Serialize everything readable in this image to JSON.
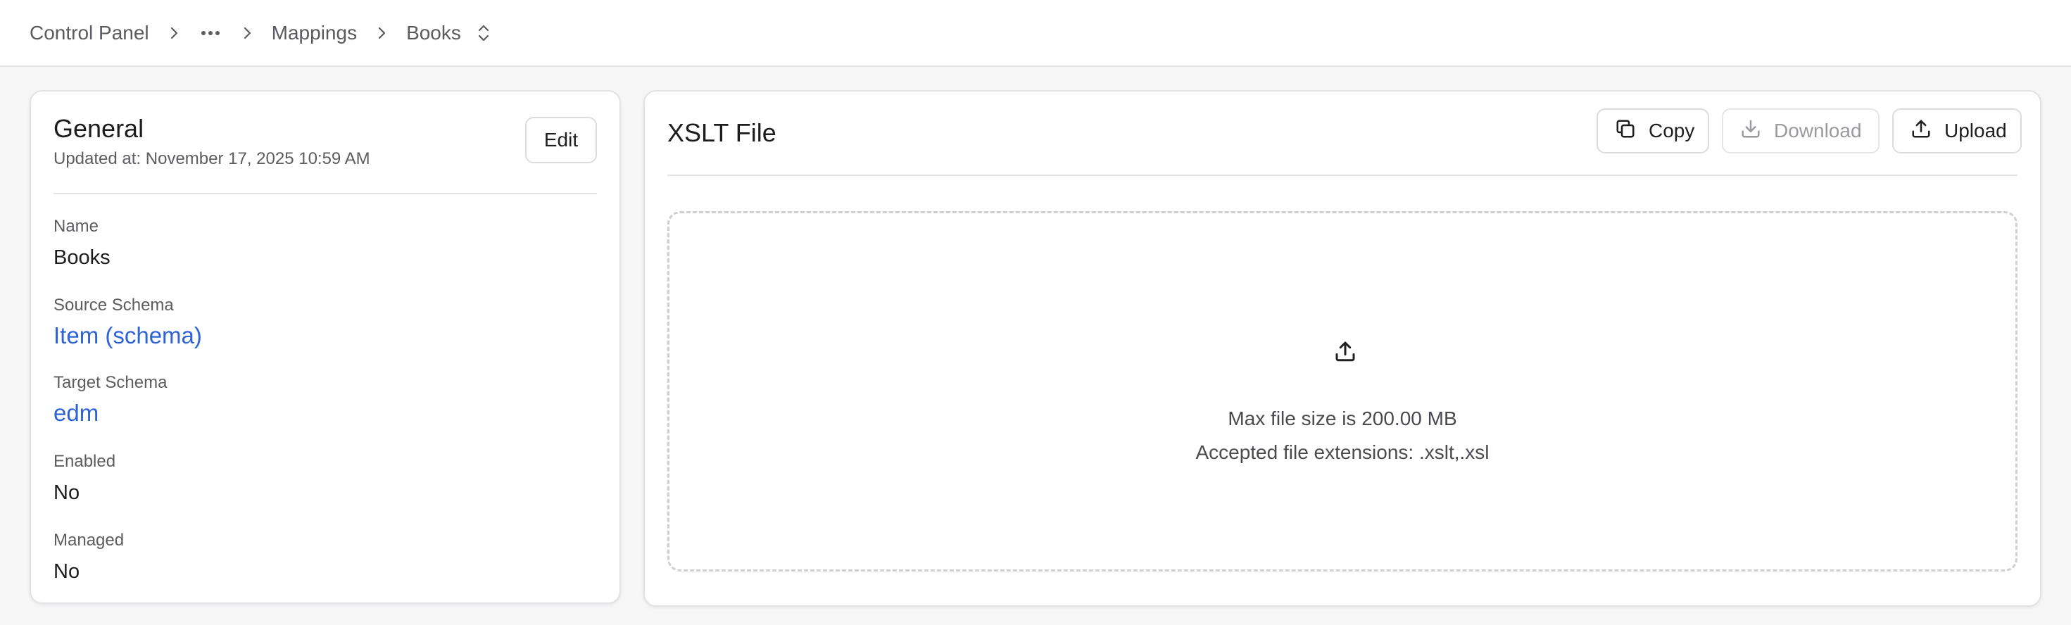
{
  "breadcrumb": {
    "items": [
      "Control Panel",
      "Mappings",
      "Books"
    ],
    "ellipsis_icon": "more-horizontal-icon",
    "separator_icon": "chevron-right-icon",
    "switcher_icon": "chevrons-up-down-icon"
  },
  "general": {
    "title": "General",
    "updated": "Updated at: November 17, 2025 10:59 AM",
    "edit_label": "Edit",
    "fields": [
      {
        "label": "Name",
        "value": "Books"
      },
      {
        "label": "Source Schema",
        "value": "Item (schema)"
      },
      {
        "label": "Target Schema",
        "value": "edm"
      },
      {
        "label": "Enabled",
        "value": "No"
      },
      {
        "label": "Managed",
        "value": "No"
      }
    ]
  },
  "xslt": {
    "title": "XSLT File",
    "copy_label": "Copy",
    "download_label": "Download",
    "upload_label": "Upload",
    "dropzone_max_size": "Max file size is 200.00 MB",
    "dropzone_extensions": "Accepted file extensions: .xslt,.xsl"
  },
  "colors": {
    "link": "#2e63d6",
    "muted_text": "#5c5c62",
    "border": "#e2e2e5",
    "background": "#f6f6f7"
  }
}
